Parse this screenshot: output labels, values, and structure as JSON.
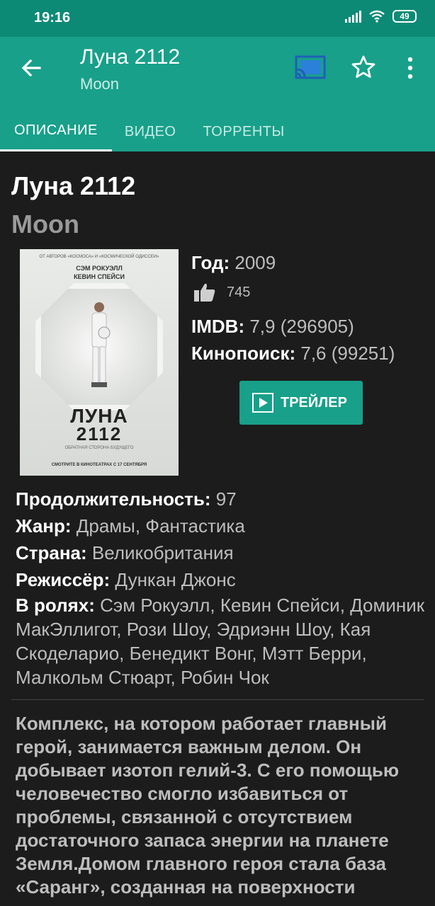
{
  "status_bar": {
    "time": "19:16",
    "battery": "49"
  },
  "app_bar": {
    "title": "Луна 2112",
    "subtitle": "Moon",
    "tabs": [
      {
        "label": "ОПИСАНИЕ",
        "active": true
      },
      {
        "label": "ВИДЕО",
        "active": false
      },
      {
        "label": "ТОРРЕНТЫ",
        "active": false
      }
    ],
    "icons": [
      "arrow-back-icon",
      "cast-icon",
      "star-outline-icon",
      "more-vert-icon"
    ]
  },
  "movie": {
    "title": "Луна 2112",
    "original_title": "Moon",
    "poster": {
      "top_text": "ОТ АВТОРОВ «КОСМОСА» И «КОСМИЧЕСКОЙ ОДИССЕИ»",
      "name1": "СЭМ РОКУЭЛЛ",
      "name2": "КЕВИН СПЕЙСИ",
      "title_line1": "ЛУНА",
      "title_line2": "2112",
      "tagline": "ОБРАТНАЯ СТОРОНА БУДУЩЕГО",
      "bottom": "СМОТРИТЕ В КИНОТЕАТРАХ С 17 СЕНТЯБРЯ"
    },
    "year_label": "Год",
    "year": "2009",
    "likes": "745",
    "imdb_label": "IMDB",
    "imdb": "7,9 (296905)",
    "kinopoisk_label": "Кинопоиск",
    "kinopoisk": "7,6 (99251)",
    "trailer_button": "ТРЕЙЛЕР",
    "duration_label": "Продолжительность",
    "duration": "97",
    "genre_label": "Жанр",
    "genre": "Драмы, Фантастика",
    "country_label": "Страна",
    "country": "Великобритания",
    "director_label": "Режиссёр",
    "director": "Дункан Джонс",
    "cast_label": "В ролях",
    "cast": "Сэм Рокуэлл, Кевин Спейси, Доминик МакЭллигот, Рози Шоу, Эдриэнн Шоу, Кая Скоделарио, Бенедикт Вонг, Мэтт Берри, Малкольм Стюарт, Робин Чок",
    "description": "Комплекс, на котором работает главный герой, занимается важным делом. Он добывает изотоп гелий-3. С его помощью человечество смогло избавиться от проблемы, связанной с отсутствием достаточного запаса энергии на планете Земля.Домом главного героя стала база «Саранг», созданная на поверхности"
  },
  "colors": {
    "primary": "#18a08a",
    "primary_dark": "#0c8a76",
    "background": "#1c1c1c"
  }
}
